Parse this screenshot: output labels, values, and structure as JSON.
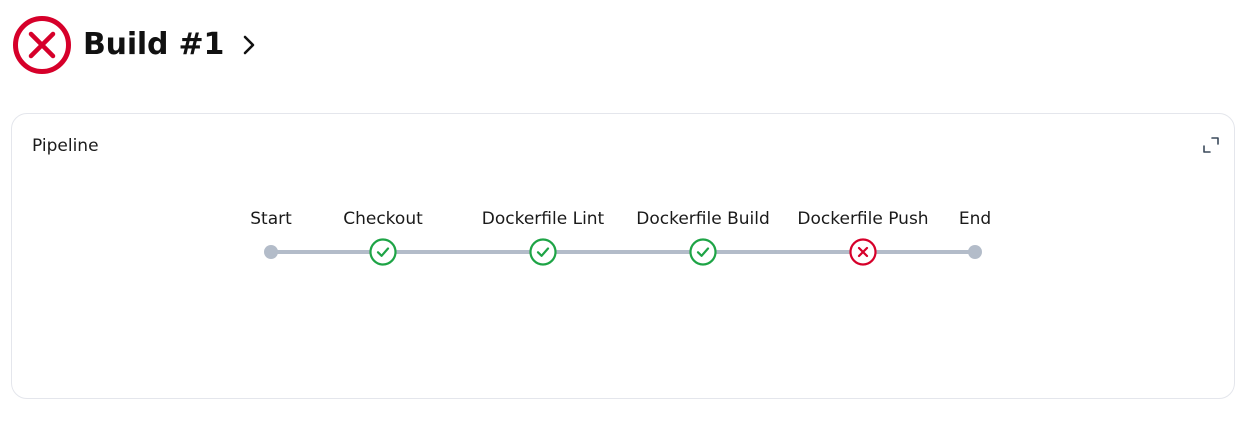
{
  "header": {
    "status": "failed",
    "status_icon": "failed-x-circle-icon",
    "title": "Build #1",
    "chevron_icon": "chevron-right-icon"
  },
  "pipeline": {
    "title": "Pipeline",
    "expand_icon": "expand-icon",
    "stages": [
      {
        "label": "Start",
        "status": "start"
      },
      {
        "label": "Checkout",
        "status": "success"
      },
      {
        "label": "Dockerfile Lint",
        "status": "success"
      },
      {
        "label": "Dockerfile Build",
        "status": "success"
      },
      {
        "label": "Dockerfile Push",
        "status": "failed"
      },
      {
        "label": "End",
        "status": "end"
      }
    ]
  },
  "colors": {
    "failed": "#d6002a",
    "success": "#1ea446",
    "track": "#b3bcc9",
    "card_border": "#e4e6ec"
  }
}
